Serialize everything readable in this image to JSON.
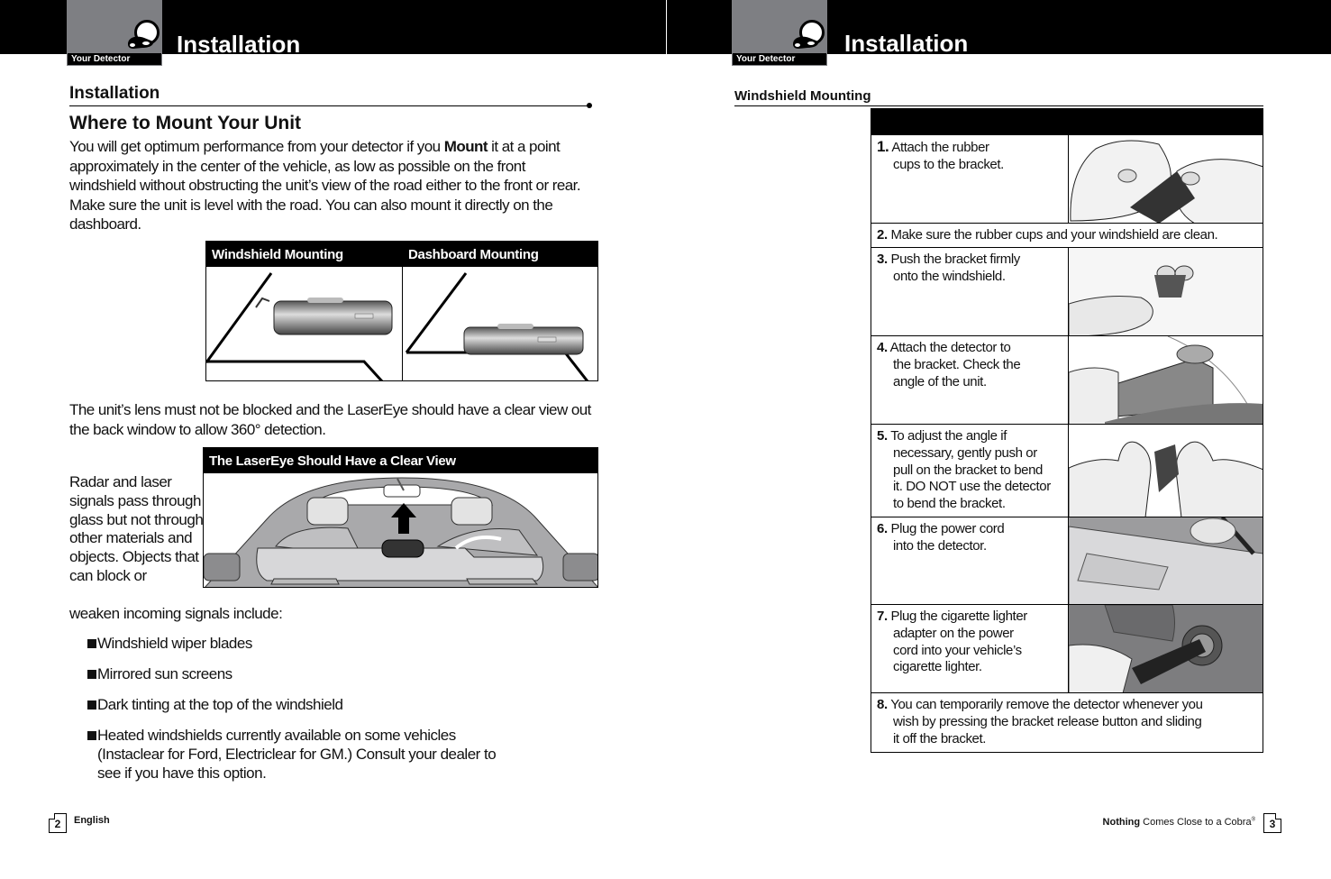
{
  "left_page": {
    "header": {
      "tab_label": "Your Detector",
      "tab_icon": "detector-icon",
      "title": "Installation"
    },
    "section_title": "Installation",
    "subsection_title": "Where to Mount Your Unit",
    "intro_before_bold": "You will get optimum performance from your detector if you ",
    "intro_bold": "Mount",
    "intro_after_bold": " it at a point approximately in the center of the vehicle, as low as possible on the front windshield without obstructing the unit’s view of the road either to the front or rear. Make sure the unit is level with the road. You can also mount it directly on the dashboard.",
    "mount_figure": {
      "windshield_label": "Windshield Mounting",
      "dashboard_label": "Dashboard Mounting"
    },
    "lens_paragraph": "The unit’s lens must not be blocked and the LaserEye should have a clear view out the back window to allow 360° detection.",
    "laser_figure": {
      "label": "The LaserEye Should Have a Clear View"
    },
    "radar_paragraph_wrapped": "Radar and laser signals pass through glass but not through other materials and objects. Objects that can block or",
    "radar_paragraph_tail": "weaken incoming signals include:",
    "bullets": [
      "Windshield wiper blades",
      "Mirrored sun screens",
      "Dark tinting at the top of the windshield",
      "Heated windshields currently available on some vehicles (Instaclear for Ford, Electriclear for GM.) Consult your dealer to see if you have this option."
    ],
    "footer": {
      "page_number": "2",
      "language": "English"
    }
  },
  "right_page": {
    "header": {
      "tab_label": "Your Detector",
      "tab_icon": "detector-icon",
      "title": "Installation"
    },
    "section_title": "Windshield Mounting",
    "steps": [
      {
        "num": "1.",
        "lines": [
          "Attach the rubber",
          "cups to the bracket."
        ],
        "image": "hands-attaching-cups"
      },
      {
        "num": "2.",
        "lines": [
          "Make sure the rubber cups and your windshield are clean."
        ]
      },
      {
        "num": "3.",
        "lines": [
          "Push the bracket firmly",
          "onto the windshield."
        ],
        "image": "hand-pushing-bracket"
      },
      {
        "num": "4.",
        "lines": [
          "Attach the detector to",
          "the bracket. Check the",
          "angle of the unit."
        ],
        "image": "detector-on-bracket"
      },
      {
        "num": "5.",
        "lines": [
          "To adjust the angle if",
          "necessary, gently push or",
          "pull on the bracket to bend",
          "it. DO NOT use the detector",
          "to bend the bracket."
        ],
        "image": "hands-bending-bracket"
      },
      {
        "num": "6.",
        "lines": [
          "Plug the power cord",
          "into the detector."
        ],
        "image": "power-cord-plug"
      },
      {
        "num": "7.",
        "lines": [
          "Plug the cigarette lighter",
          "adapter on the power",
          "cord into your vehicle’s",
          "cigarette lighter."
        ],
        "image": "cigarette-lighter-plug"
      },
      {
        "num": "8.",
        "lines": [
          "You can temporarily remove the detector whenever you",
          "wish by pressing the bracket release button and sliding",
          "it off the bracket."
        ]
      }
    ],
    "footer": {
      "tagline_bold": "Nothing",
      "tagline_rest": " Comes Close to a Cobra",
      "registered_mark": "®",
      "page_number": "3"
    }
  }
}
